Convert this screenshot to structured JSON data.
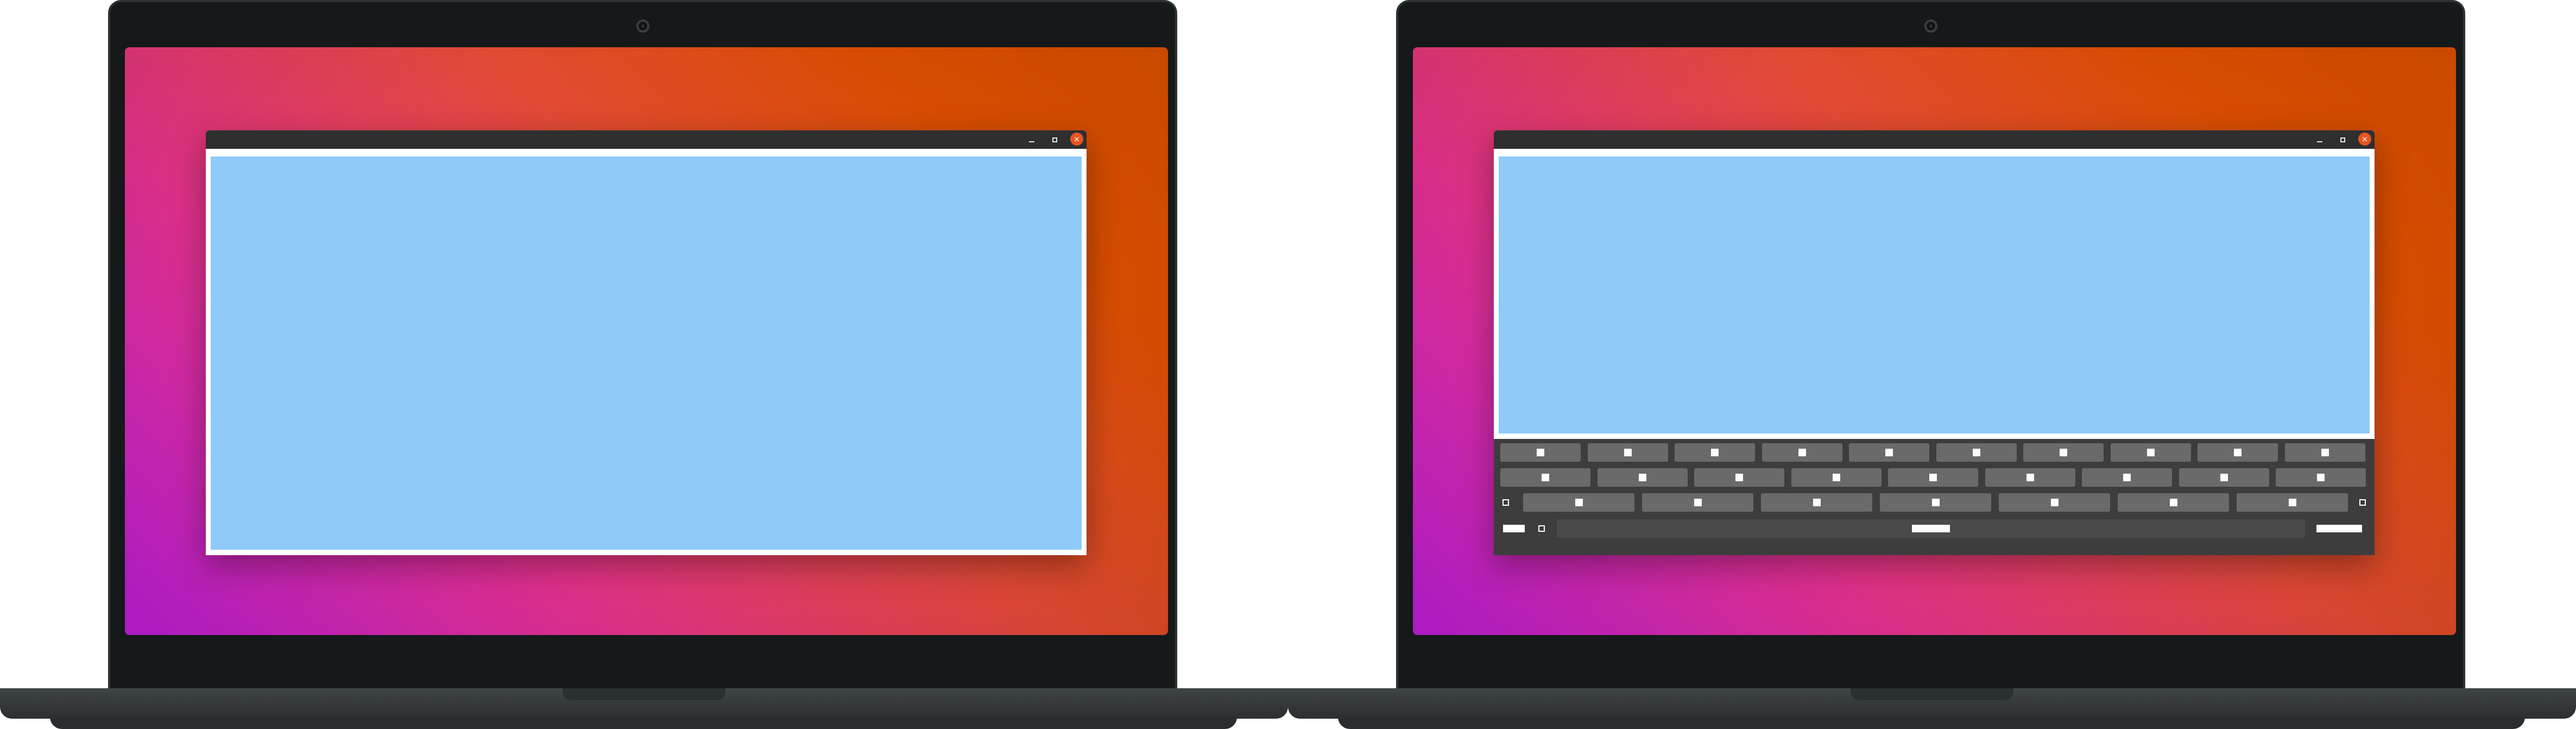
{
  "scene": {
    "laptops": [
      {
        "id": "without-keyboard",
        "window": {
          "controls": [
            "minimize-icon",
            "maximize-icon",
            "close-icon"
          ],
          "content_color": "#90caf9"
        },
        "on_screen_keyboard": false
      },
      {
        "id": "with-keyboard",
        "window": {
          "controls": [
            "minimize-icon",
            "maximize-icon",
            "close-icon"
          ],
          "content_color": "#90caf9"
        },
        "on_screen_keyboard": true
      }
    ],
    "colors": {
      "laptop_body": "#15191a",
      "wallpaper_start": "#b81dd3",
      "wallpaper_end": "#d64e00",
      "titlebar": "#2f2f2f",
      "close_button": "#e95420",
      "keyboard_background": "#3d3d3d",
      "key": "#6a6a6a"
    }
  },
  "keyboard": {
    "rows": [
      {
        "keys": 10
      },
      {
        "keys": 9
      },
      {
        "keys": 7,
        "edge_keys": 2
      },
      {
        "keys": 1,
        "side_keys": 3
      }
    ]
  }
}
